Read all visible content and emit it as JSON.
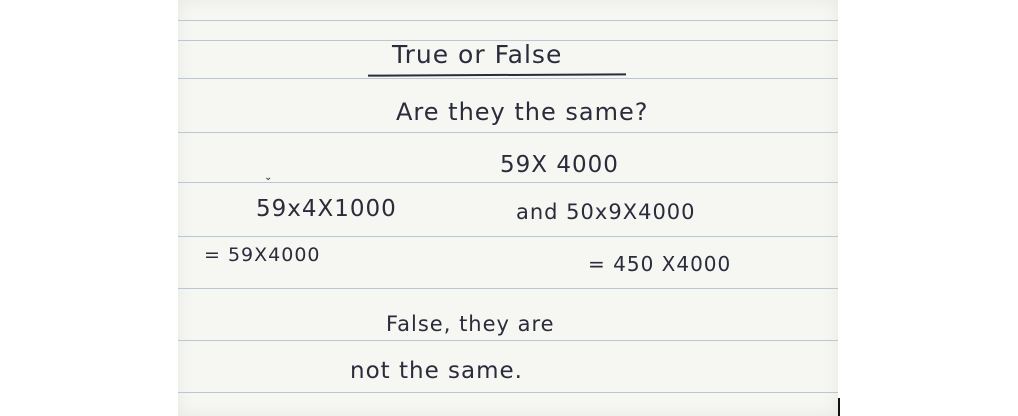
{
  "note": {
    "title": "True or False",
    "question": "Are they the same?",
    "expression": "59X 4000",
    "left_expr": "59x4X1000",
    "left_result": "= 59X4000",
    "right_expr": "and 50x9X4000",
    "right_result": "= 450 X4000",
    "answer_line1": "False, they are",
    "answer_line2": "not the same."
  },
  "colors": {
    "ink": "#2a2c3b",
    "paper": "#f6f6f3",
    "rule": "#b9c6d3"
  }
}
